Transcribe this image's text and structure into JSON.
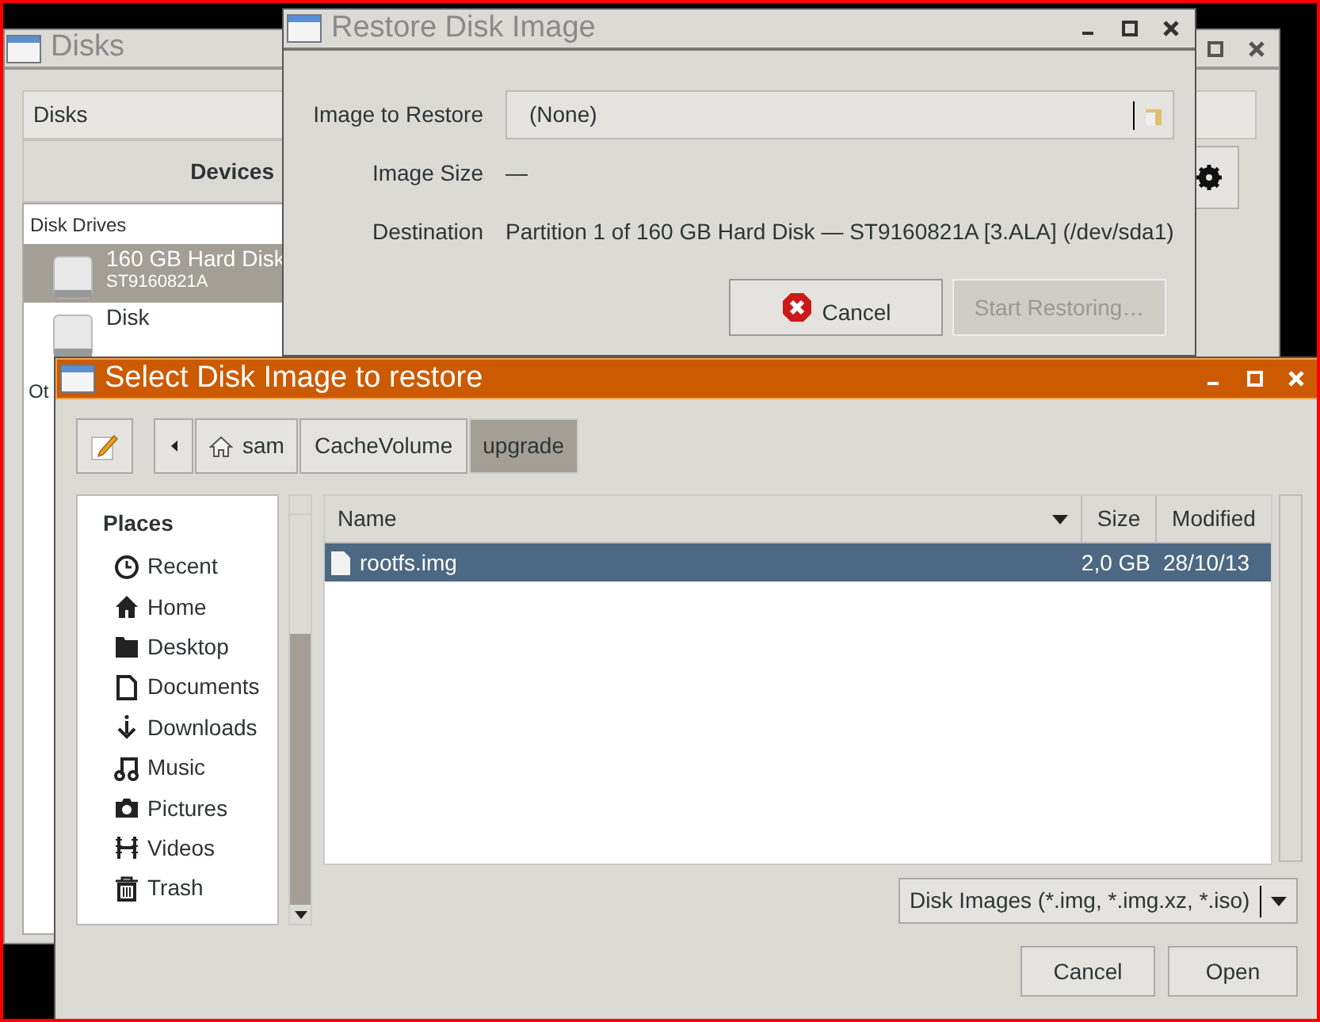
{
  "disks_window": {
    "title": "Disks",
    "header": "Disks",
    "section_title": "Devices",
    "drive_group": "Disk Drives",
    "drives": [
      {
        "name": "160 GB Hard Disk",
        "detail": "ST9160821A",
        "selected": true
      },
      {
        "name": "Disk",
        "selected": false
      }
    ],
    "other_group": "Ot"
  },
  "restore_dialog": {
    "title": "Restore Disk Image",
    "fields": [
      {
        "label": "Image to Restore",
        "kind": "file_button",
        "value": "(None)"
      },
      {
        "label": "Image Size",
        "kind": "text",
        "value": "—"
      },
      {
        "label": "Destination",
        "kind": "text",
        "value": "Partition 1 of 160 GB Hard Disk — ST9160821A [3.ALA] (/dev/sda1)"
      }
    ],
    "buttons": [
      {
        "label": "Cancel",
        "kind": "cancel",
        "disabled": false
      },
      {
        "label": "Start Restoring…",
        "kind": "plain",
        "disabled": true
      }
    ]
  },
  "file_chooser": {
    "title": "Select Disk Image to restore",
    "path": [
      {
        "label": "sam",
        "kind": "home",
        "selected": false
      },
      {
        "label": "CacheVolume",
        "kind": "folder",
        "selected": false
      },
      {
        "label": "upgrade",
        "kind": "folder",
        "selected": true
      }
    ],
    "places_title": "Places",
    "places": [
      {
        "label": "Recent",
        "kind": "recent"
      },
      {
        "label": "Home",
        "kind": "home"
      },
      {
        "label": "Desktop",
        "kind": "desktop"
      },
      {
        "label": "Documents",
        "kind": "documents"
      },
      {
        "label": "Downloads",
        "kind": "downloads"
      },
      {
        "label": "Music",
        "kind": "music"
      },
      {
        "label": "Pictures",
        "kind": "pictures"
      },
      {
        "label": "Videos",
        "kind": "videos"
      },
      {
        "label": "Trash",
        "kind": "trash"
      }
    ],
    "columns": [
      "Name",
      "Size",
      "Modified"
    ],
    "rows": [
      {
        "name": "rootfs.img",
        "size": "2,0 GB",
        "modified": "28/10/13",
        "selected": true
      }
    ],
    "filter": "Disk Images (*.img, *.img.xz, *.iso)",
    "buttons": [
      "Cancel",
      "Open"
    ]
  }
}
